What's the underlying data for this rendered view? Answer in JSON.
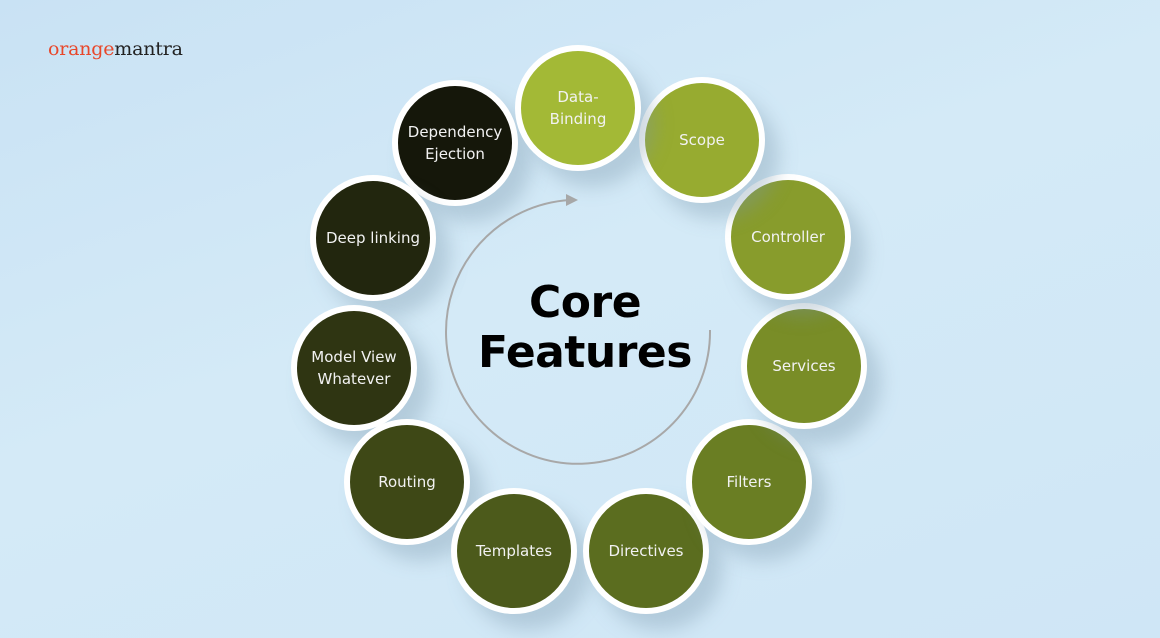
{
  "logo": {
    "part1": "orange",
    "part2": "mantra"
  },
  "title": {
    "line1": "Core",
    "line2": "Features"
  },
  "features": [
    {
      "label": "Data-\nBinding",
      "color": "#a3b936"
    },
    {
      "label": "Scope",
      "color": "#97ab30"
    },
    {
      "label": "Controller",
      "color": "#889c2c"
    },
    {
      "label": "Services",
      "color": "#798d27"
    },
    {
      "label": "Filters",
      "color": "#6a7e23"
    },
    {
      "label": "Directives",
      "color": "#5b6d1f"
    },
    {
      "label": "Templates",
      "color": "#4c5a1b"
    },
    {
      "label": "Routing",
      "color": "#3e4816"
    },
    {
      "label": "Model View\nWhatever",
      "color": "#2f3512"
    },
    {
      "label": "Deep linking",
      "color": "#22260e"
    },
    {
      "label": "Dependency\nEjection",
      "color": "#15170a"
    }
  ]
}
